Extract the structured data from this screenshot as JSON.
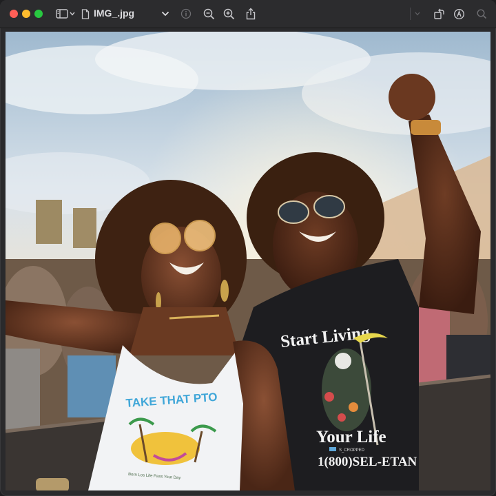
{
  "window": {
    "title": "IMG_.jpg"
  },
  "toolbar": {
    "icons": [
      "sidebar-toggle-icon",
      "chevron-down-icon",
      "document-icon",
      "title-menu-chevron-icon",
      "info-icon",
      "zoom-out-icon",
      "zoom-in-icon",
      "share-icon",
      "rotate-icon",
      "markup-icon",
      "search-icon"
    ]
  },
  "photo": {
    "shirt_left_text": "TAKE THAT PTO",
    "shirt_left_subtext": "Born Los Life Pass Your Day",
    "shirt_right_line1": "Start Living",
    "shirt_right_line2": "Your Life",
    "shirt_right_phone": "1(800)SEL-ETAN",
    "shirt_right_tag": "S_CROPPED"
  },
  "colors": {
    "toolbar": "#2c2c2e",
    "close": "#ff5f57",
    "minimize": "#febc2e",
    "maximize": "#28c840"
  }
}
